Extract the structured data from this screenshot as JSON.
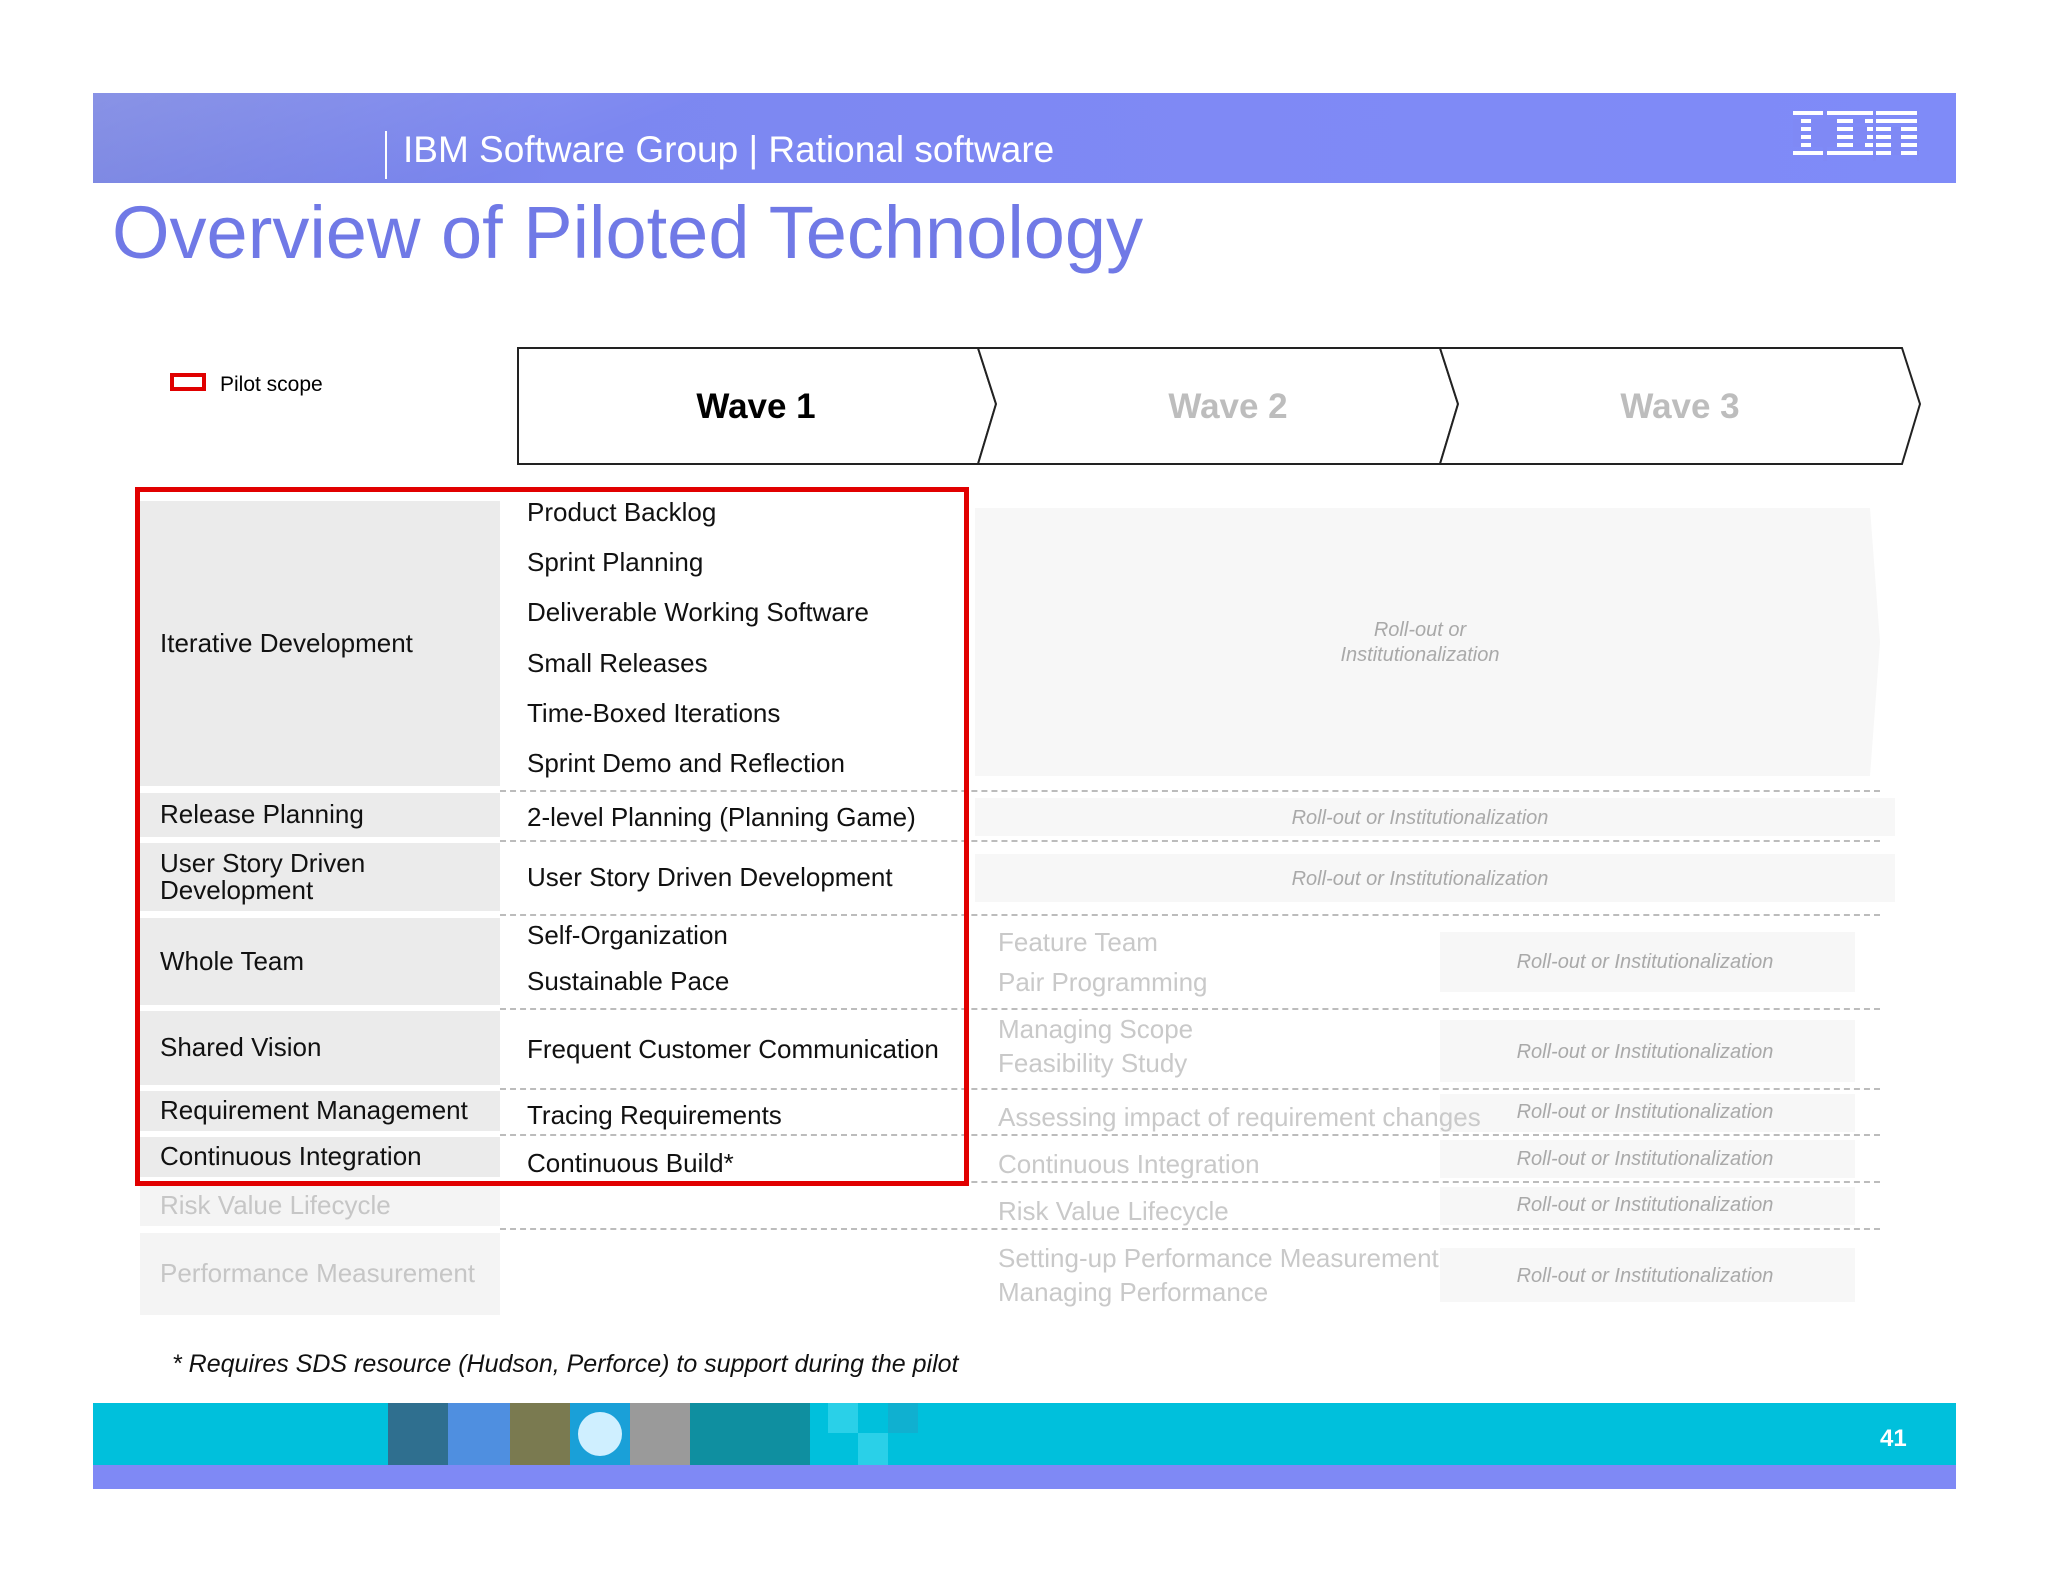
{
  "header": {
    "group_text": "IBM Software Group | Rational software",
    "logo_text": "IBM"
  },
  "title": "Overview of Piloted Technology",
  "legend": {
    "label": "Pilot scope"
  },
  "waves": [
    "Wave 1",
    "Wave 2",
    "Wave 3"
  ],
  "categories": [
    "Iterative Development",
    "Release Planning",
    "User Story Driven Development",
    "Whole Team",
    "Shared Vision",
    "Requirement Management",
    "Continuous Integration",
    "Risk Value Lifecycle",
    "Performance Measurement"
  ],
  "wave1_items": [
    "Product Backlog",
    "Sprint Planning",
    "Deliverable Working Software",
    "Small Releases",
    "Time-Boxed Iterations",
    "Sprint Demo and Reflection",
    "2-level Planning (Planning Game)",
    "User Story Driven Development",
    "Self-Organization",
    "Sustainable Pace",
    "Frequent Customer Communication",
    "Tracing Requirements",
    "Continuous Build*"
  ],
  "wave2_items": [
    "Feature Team",
    "Pair Programming",
    "Managing Scope",
    "Feasibility Study",
    "Assessing impact of requirement changes",
    "Continuous Integration",
    "Risk Value Lifecycle",
    "Setting-up Performance Measurement",
    "Managing Performance"
  ],
  "rollout": {
    "large": "Roll-out or\nInstitutionalization",
    "label": "Roll-out or Institutionalization"
  },
  "footnote": "* Requires SDS resource (Hudson, Perforce) to support during the pilot",
  "page_number": "41",
  "colors": {
    "brand_blue": "#7f89f5",
    "title_blue": "#7079e6",
    "pilot_red": "#e10000",
    "footer_cyan": "#00c0dc"
  }
}
